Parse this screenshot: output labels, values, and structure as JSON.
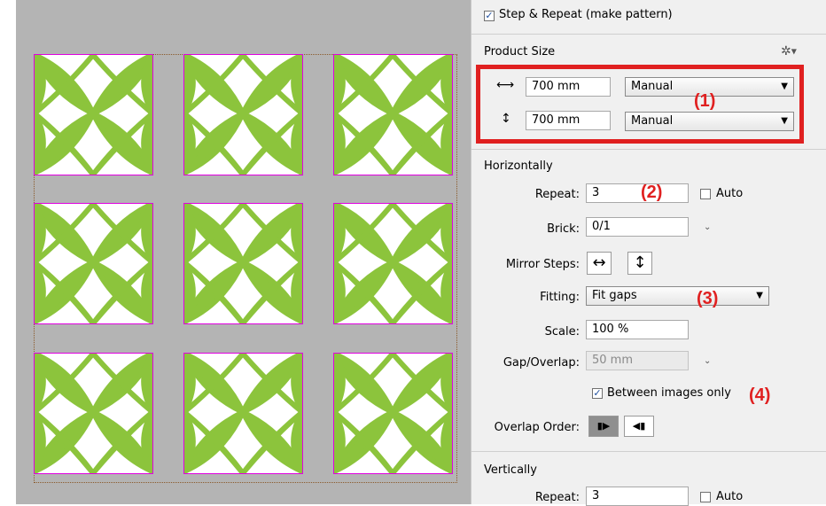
{
  "colors": {
    "leaf": "#8cc43c",
    "tile_border": "#e000e0",
    "canvas": "#b4b4b4",
    "annotation": "#e02020"
  },
  "step_repeat": {
    "label": "Step & Repeat (make pattern)",
    "checked": true
  },
  "product_size": {
    "title": "Product Size",
    "settings_icon": "gear-icon",
    "width": {
      "value": "700 mm",
      "mode": "Manual"
    },
    "height": {
      "value": "700 mm",
      "mode": "Manual"
    }
  },
  "horizontally": {
    "title": "Horizontally",
    "repeat": {
      "label": "Repeat:",
      "value": "3",
      "auto_label": "Auto",
      "auto_checked": false
    },
    "brick": {
      "label": "Brick:",
      "value": "0/1"
    },
    "mirror_steps": {
      "label": "Mirror Steps:"
    },
    "fitting": {
      "label": "Fitting:",
      "value": "Fit gaps"
    },
    "scale": {
      "label": "Scale:",
      "value": "100 %"
    },
    "gap_overlap": {
      "label": "Gap/Overlap:",
      "value": "50 mm"
    },
    "between_images": {
      "label": "Between images only",
      "checked": true
    },
    "overlap_order": {
      "label": "Overlap Order:"
    }
  },
  "vertically": {
    "title": "Vertically",
    "repeat": {
      "label": "Repeat:",
      "value": "3",
      "auto_label": "Auto"
    }
  },
  "annotations": [
    "(1)",
    "(2)",
    "(3)",
    "(4)"
  ],
  "tiles": {
    "rows": 3,
    "cols": 3
  }
}
